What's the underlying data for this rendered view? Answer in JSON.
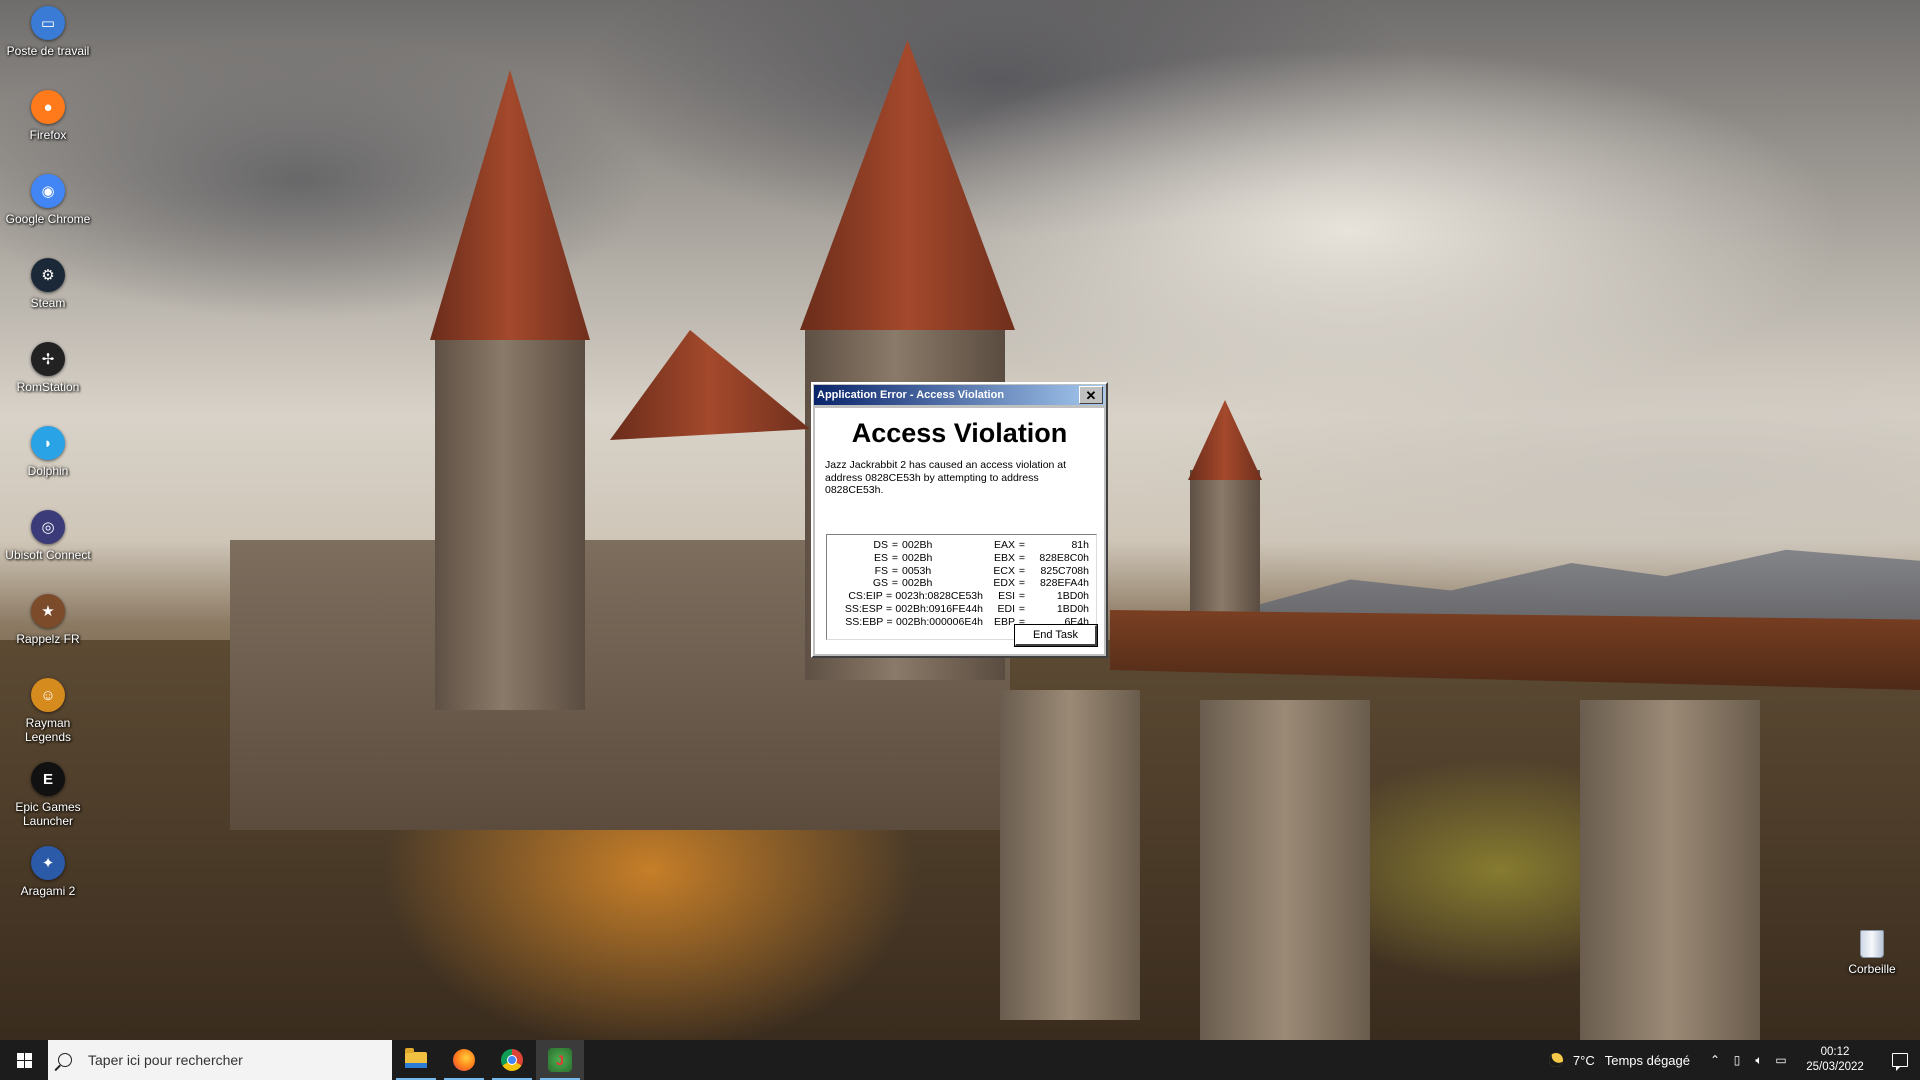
{
  "desktop": {
    "icons": [
      {
        "label": "Poste de travail",
        "icon": "computer-icon",
        "color": "#3a7bd5",
        "glyph": "▭"
      },
      {
        "label": "Firefox",
        "icon": "firefox-icon",
        "color": "#ff7a1a",
        "glyph": "●"
      },
      {
        "label": "Google Chrome",
        "icon": "chrome-icon",
        "color": "#4285f4",
        "glyph": "◉"
      },
      {
        "label": "Steam",
        "icon": "steam-icon",
        "color": "#1b2838",
        "glyph": "⚙"
      },
      {
        "label": "RomStation",
        "icon": "romstation-icon",
        "color": "#222222",
        "glyph": "✢"
      },
      {
        "label": "Dolphin",
        "icon": "dolphin-icon",
        "color": "#2aa2e6",
        "glyph": "◗"
      },
      {
        "label": "Ubisoft Connect",
        "icon": "ubisoft-icon",
        "color": "#3b3b7a",
        "glyph": "◎"
      },
      {
        "label": "Rappelz FR",
        "icon": "rappelz-icon",
        "color": "#7b4b2a",
        "glyph": "★"
      },
      {
        "label": "Rayman Legends",
        "icon": "rayman-icon",
        "color": "#d68b1f",
        "glyph": "☺"
      },
      {
        "label": "Epic Games Launcher",
        "icon": "epic-games-icon",
        "color": "#111111",
        "glyph": "E"
      },
      {
        "label": "Aragami 2",
        "icon": "aragami-icon",
        "color": "#2a5aa8",
        "glyph": "✦"
      }
    ],
    "recycle_bin": {
      "label": "Corbeille"
    }
  },
  "dialog": {
    "title": "Application Error - Access Violation",
    "close_glyph": "✕",
    "heading": "Access Violation",
    "message": "Jazz Jackrabbit 2 has caused an access violation at address 0828CE53h by attempting to  address 0828CE53h.",
    "registers_left": [
      {
        "name": "DS",
        "value": "002Bh"
      },
      {
        "name": "ES",
        "value": "002Bh"
      },
      {
        "name": "FS",
        "value": "0053h"
      },
      {
        "name": "GS",
        "value": "002Bh"
      },
      {
        "name": "CS:EIP",
        "value": "0023h:0828CE53h"
      },
      {
        "name": "SS:ESP",
        "value": "002Bh:0916FE44h"
      },
      {
        "name": "SS:EBP",
        "value": "002Bh:000006E4h"
      }
    ],
    "registers_right": [
      {
        "name": "EAX",
        "value": "81h"
      },
      {
        "name": "EBX",
        "value": "828E8C0h"
      },
      {
        "name": "ECX",
        "value": "825C708h"
      },
      {
        "name": "EDX",
        "value": "828EFA4h"
      },
      {
        "name": "ESI",
        "value": "1BD0h"
      },
      {
        "name": "EDI",
        "value": "1BD0h"
      },
      {
        "name": "EBP",
        "value": "6E4h"
      }
    ],
    "end_task_label": "End Task"
  },
  "taskbar": {
    "search_placeholder": "Taper ici pour rechercher",
    "apps": [
      {
        "name": "file-explorer",
        "active": false
      },
      {
        "name": "firefox",
        "active": false
      },
      {
        "name": "chrome",
        "active": false
      },
      {
        "name": "jazz-jackrabbit-2",
        "active": true
      }
    ],
    "weather": {
      "temp": "7°C",
      "condition": "Temps dégagé"
    },
    "clock": {
      "time": "00:12",
      "date": "25/03/2022"
    }
  }
}
